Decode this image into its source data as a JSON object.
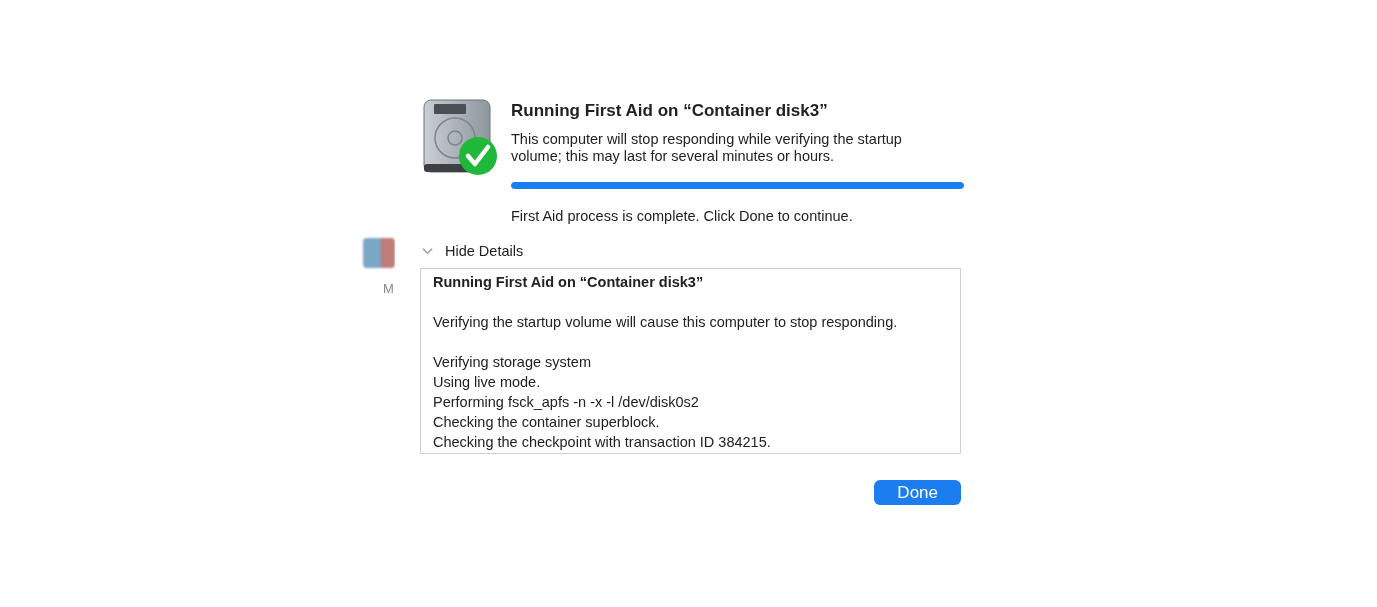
{
  "background": {
    "label": "M"
  },
  "dialog": {
    "title": "Running First Aid on “Container disk3”",
    "message": "This computer will stop responding while verifying the startup volume; this may last for several minutes or hours.",
    "progress": {
      "level": 1
    },
    "status": "First Aid process is complete. Click Done to continue.",
    "details_toggle": {
      "label": "Hide Details",
      "expanded": true
    },
    "log": [
      {
        "text": "Running First Aid on “Container disk3”",
        "kind": "heading"
      },
      {
        "text": "Verifying the startup volume will cause this computer to stop responding.",
        "kind": "line"
      },
      {
        "text": "Verifying storage system",
        "kind": "line"
      },
      {
        "text": "Using live mode.",
        "kind": "line"
      },
      {
        "text": "Performing fsck_apfs -n -x -l /dev/disk0s2",
        "kind": "line"
      },
      {
        "text": "Checking the container superblock.",
        "kind": "line"
      },
      {
        "text": "Checking the checkpoint with transaction ID 384215.",
        "kind": "line"
      }
    ],
    "buttons": [
      {
        "label": "Done",
        "kind": "default"
      }
    ]
  }
}
